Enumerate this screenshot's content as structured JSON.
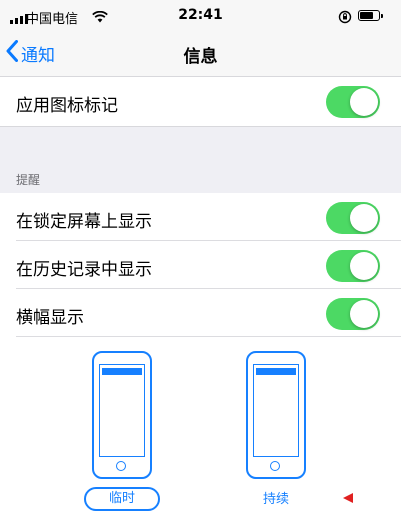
{
  "status_bar": {
    "carrier": "中国电信",
    "time": "22:41",
    "battery_level": 0.7
  },
  "nav": {
    "back_label": "通知",
    "title": "信息"
  },
  "badge_row": {
    "label": "应用图标标记",
    "on": true
  },
  "alerts_section": {
    "header": "提醒",
    "items": [
      {
        "label": "在锁定屏幕上显示",
        "on": true
      },
      {
        "label": "在历史记录中显示",
        "on": true
      },
      {
        "label": "横幅显示",
        "on": true
      }
    ]
  },
  "banner_style": {
    "options": [
      {
        "label": "临时",
        "selected": true
      },
      {
        "label": "持续",
        "selected": false
      }
    ]
  },
  "colors": {
    "accent": "#0a7aff",
    "toggle_on": "#4cd964",
    "marker": "#e02020"
  },
  "icons": [
    "signal-icon",
    "wifi-icon",
    "orientation-lock-icon",
    "battery-icon",
    "chevron-left-icon",
    "phone-illustration",
    "red-marker-arrow"
  ]
}
